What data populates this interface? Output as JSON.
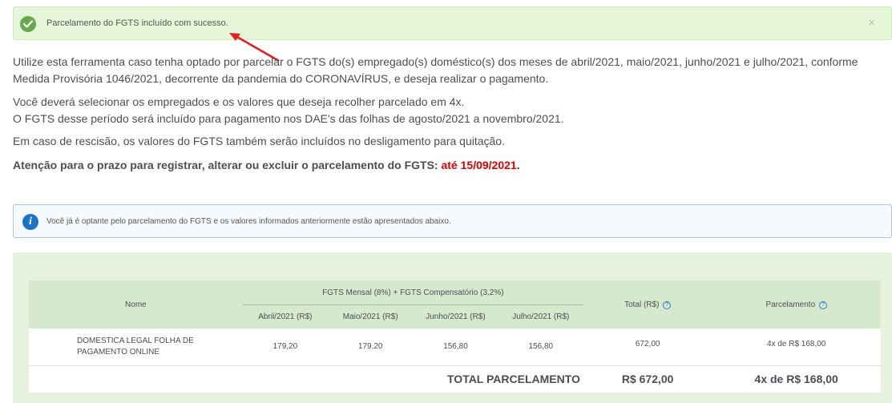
{
  "success_alert": {
    "message": "Parcelamento do FGTS incluído com sucesso.",
    "close": "×"
  },
  "intro": {
    "p1": "Utilize esta ferramenta caso tenha optado por parcelar o FGTS do(s) empregado(s) doméstico(s) dos meses de abril/2021, maio/2021, junho/2021 e julho/2021, conforme Medida Provisória 1046/2021, decorrente da pandemia do CORONAVÍRUS, e deseja realizar o pagamento.",
    "p2a": "Você deverá selecionar os empregados e os valores que deseja recolher parcelado em 4x.",
    "p2b": "O FGTS desse período será incluído para pagamento nos DAE's das folhas de agosto/2021 a novembro/2021.",
    "p3": "Em caso de rescisão, os valores do FGTS também serão incluídos no desligamento para quitação.",
    "attention": "Atenção para o prazo para registrar, alterar ou excluir o parcelamento do FGTS:",
    "deadline": "até 15/09/2021."
  },
  "info_alert": {
    "icon": "i",
    "message": "Você já é optante pelo parcelamento do FGTS e os valores informados anteriormente estão apresentados abaixo."
  },
  "table": {
    "headers": {
      "name": "Nome",
      "group": "FGTS Mensal (8%) + FGTS Compensatório (3,2%)",
      "months": [
        "Abril/2021 (R$)",
        "Maio/2021 (R$)",
        "Junho/2021 (R$)",
        "Julho/2021 (R$)"
      ],
      "total": "Total (R$)",
      "installment": "Parcelamento",
      "help": "?"
    },
    "rows": [
      {
        "name_line1": "DOMESTICA LEGAL FOLHA DE",
        "name_line2": "PAGAMENTO ONLINE",
        "values": [
          "179,20",
          "179,20",
          "156,80",
          "156,80"
        ],
        "total": "672,00",
        "installment": "4x de R$ 168,00"
      }
    ],
    "footer": {
      "label": "TOTAL PARCELAMENTO",
      "total": "R$ 672,00",
      "installment": "4x de R$ 168,00"
    }
  },
  "colors": {
    "success_bg": "#e6f7d9",
    "deadline_red": "#e00000",
    "info_icon": "#1a73c7",
    "table_header": "#d6e9cd",
    "annotation_arrow": "#e02020"
  }
}
